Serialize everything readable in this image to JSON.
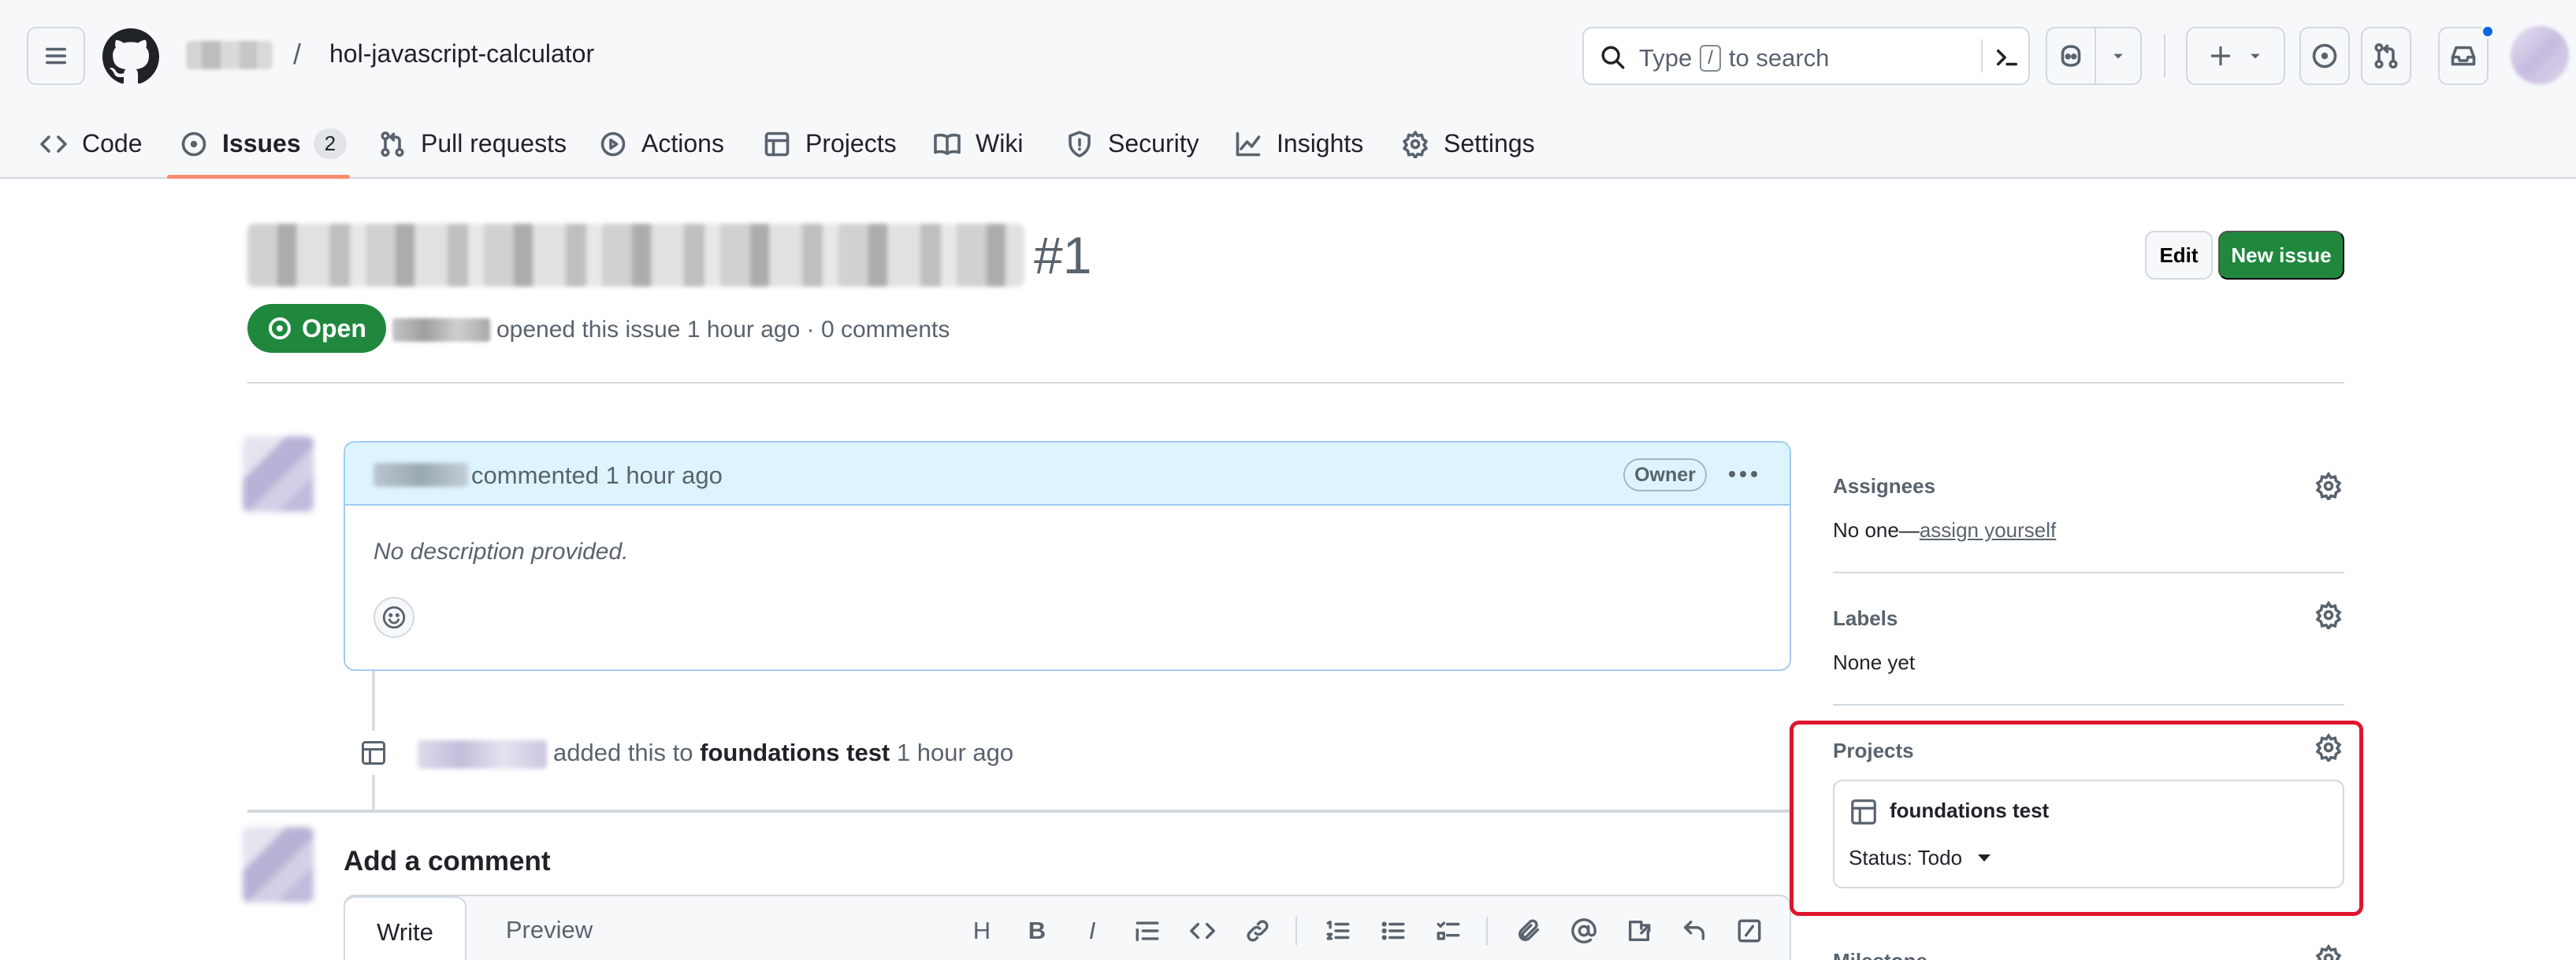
{
  "header": {
    "repo_name": "hol-javascript-calculator",
    "separator": "/",
    "search": {
      "text_before": "Type",
      "shortcut": "/",
      "text_after": "to search"
    }
  },
  "tabs": [
    {
      "label": "Code",
      "icon": "code-icon"
    },
    {
      "label": "Issues",
      "icon": "issue-opened-icon",
      "count": "2",
      "selected": true
    },
    {
      "label": "Pull requests",
      "icon": "git-pull-request-icon"
    },
    {
      "label": "Actions",
      "icon": "play-icon"
    },
    {
      "label": "Projects",
      "icon": "table-icon"
    },
    {
      "label": "Wiki",
      "icon": "book-icon"
    },
    {
      "label": "Security",
      "icon": "shield-icon"
    },
    {
      "label": "Insights",
      "icon": "graph-icon"
    },
    {
      "label": "Settings",
      "icon": "gear-icon"
    }
  ],
  "issue": {
    "number": "#1",
    "edit_label": "Edit",
    "new_issue_label": "New issue",
    "state": "Open",
    "meta": "opened this issue 1 hour ago · 0 comments"
  },
  "comment": {
    "header_text": "commented 1 hour ago",
    "role_badge": "Owner",
    "body": "No description provided."
  },
  "event": {
    "text_before": "added this to",
    "project": "foundations test",
    "time": "1 hour ago"
  },
  "composer": {
    "title": "Add a comment",
    "write_tab": "Write",
    "preview_tab": "Preview",
    "heading_tool": "H",
    "bold_tool": "B",
    "italic_tool": "I"
  },
  "sidebar": {
    "assignees": {
      "title": "Assignees",
      "value_prefix": "No one—",
      "link": "assign yourself"
    },
    "labels": {
      "title": "Labels",
      "value": "None yet"
    },
    "projects": {
      "title": "Projects",
      "project_name": "foundations test",
      "status": "Status: Todo"
    },
    "milestone": {
      "title": "Milestone"
    }
  },
  "colors": {
    "primary_green": "#1f883d",
    "tab_underline": "#fd8c73",
    "comment_header_bg": "#ddf4ff",
    "highlight_red": "#e0152d",
    "notification_dot": "#0969da"
  }
}
